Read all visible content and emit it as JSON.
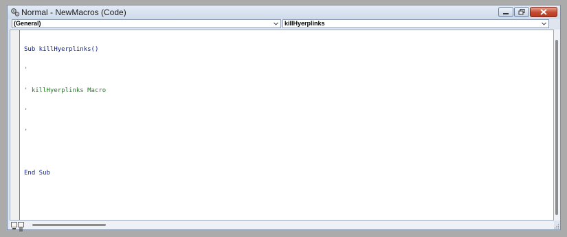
{
  "window": {
    "title": "Normal - NewMacros (Code)",
    "icon": "vba-code-module-icon"
  },
  "controls": {
    "minimize_icon": "minimize-icon",
    "restore_icon": "restore-icon",
    "close_icon": "close-icon"
  },
  "object_dropdown": {
    "value": "(General)"
  },
  "procedure_dropdown": {
    "value": "killHyerplinks"
  },
  "code": {
    "lines": [
      {
        "text": "Sub killHyerplinks()",
        "kind": "keyword"
      },
      {
        "text": "'",
        "kind": "comment"
      },
      {
        "text": "' killHyerplinks Macro",
        "kind": "comment"
      },
      {
        "text": "'",
        "kind": "comment"
      },
      {
        "text": "'",
        "kind": "comment"
      },
      {
        "text": "",
        "kind": "plain"
      },
      {
        "text": "End Sub",
        "kind": "keyword"
      }
    ]
  },
  "colors": {
    "keyword": "#0a1e8a",
    "comment": "#1e7d1e",
    "close_button": "#c4492f"
  }
}
